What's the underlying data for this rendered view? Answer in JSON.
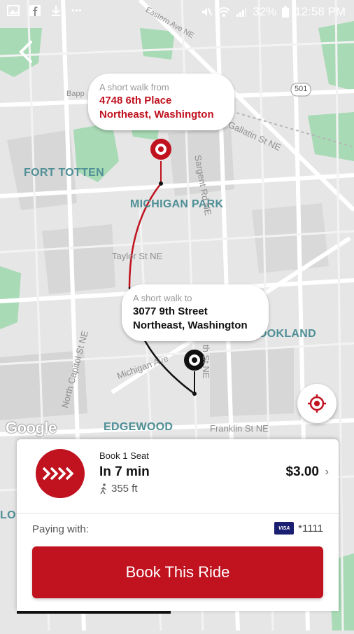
{
  "status_bar": {
    "battery": "32%",
    "time": "12:58 PM",
    "more_dots": "•••"
  },
  "map": {
    "labels": {
      "fort_totten": "FORT TOTTEN",
      "michigan_park": "MICHIGAN PARK",
      "brookland": "OOKLAND",
      "edgewood": "EDGEWOOD",
      "lo": "LO"
    },
    "streets": {
      "taylor_st": "Taylor St NE",
      "sargent_rd": "Sargent Rd NE",
      "n_capitol_st": "North Capitol St NE",
      "michigan_ave": "Michigan Ave",
      "franklin_st": "Franklin St NE",
      "eastern_ave": "Eastern Ave NE",
      "gallatin_st": "Gallatin St NE",
      "th_st": "th St NE",
      "route_501": "501",
      "bapp": "Bapp"
    },
    "pickup": {
      "prefix": "A short walk from",
      "address_line1": "4748 6th Place",
      "address_line2": "Northeast, Washington"
    },
    "dropoff": {
      "prefix": "A short walk to",
      "address_line1": "3077 9th Street",
      "address_line2": "Northeast, Washington"
    },
    "google_logo": "Google"
  },
  "ride": {
    "type": "Book 1 Seat",
    "eta": "In 7 min",
    "walk_distance": "355 ft",
    "price": "$3.00",
    "chevron": "›"
  },
  "payment": {
    "label": "Paying with:",
    "card_brand": "VISA",
    "card_last4": "*1111"
  },
  "book_button": "Book This Ride",
  "icons": {
    "back": "back-arrow-icon",
    "locate": "locate-icon",
    "walk": "walking-person-icon",
    "ride_logo": "chevrons-icon"
  },
  "colors": {
    "brand_red": "#c0121f",
    "map_bg": "#e6e6e6",
    "park_green": "#a8dab5",
    "neighborhood_label": "#4f8f96"
  }
}
